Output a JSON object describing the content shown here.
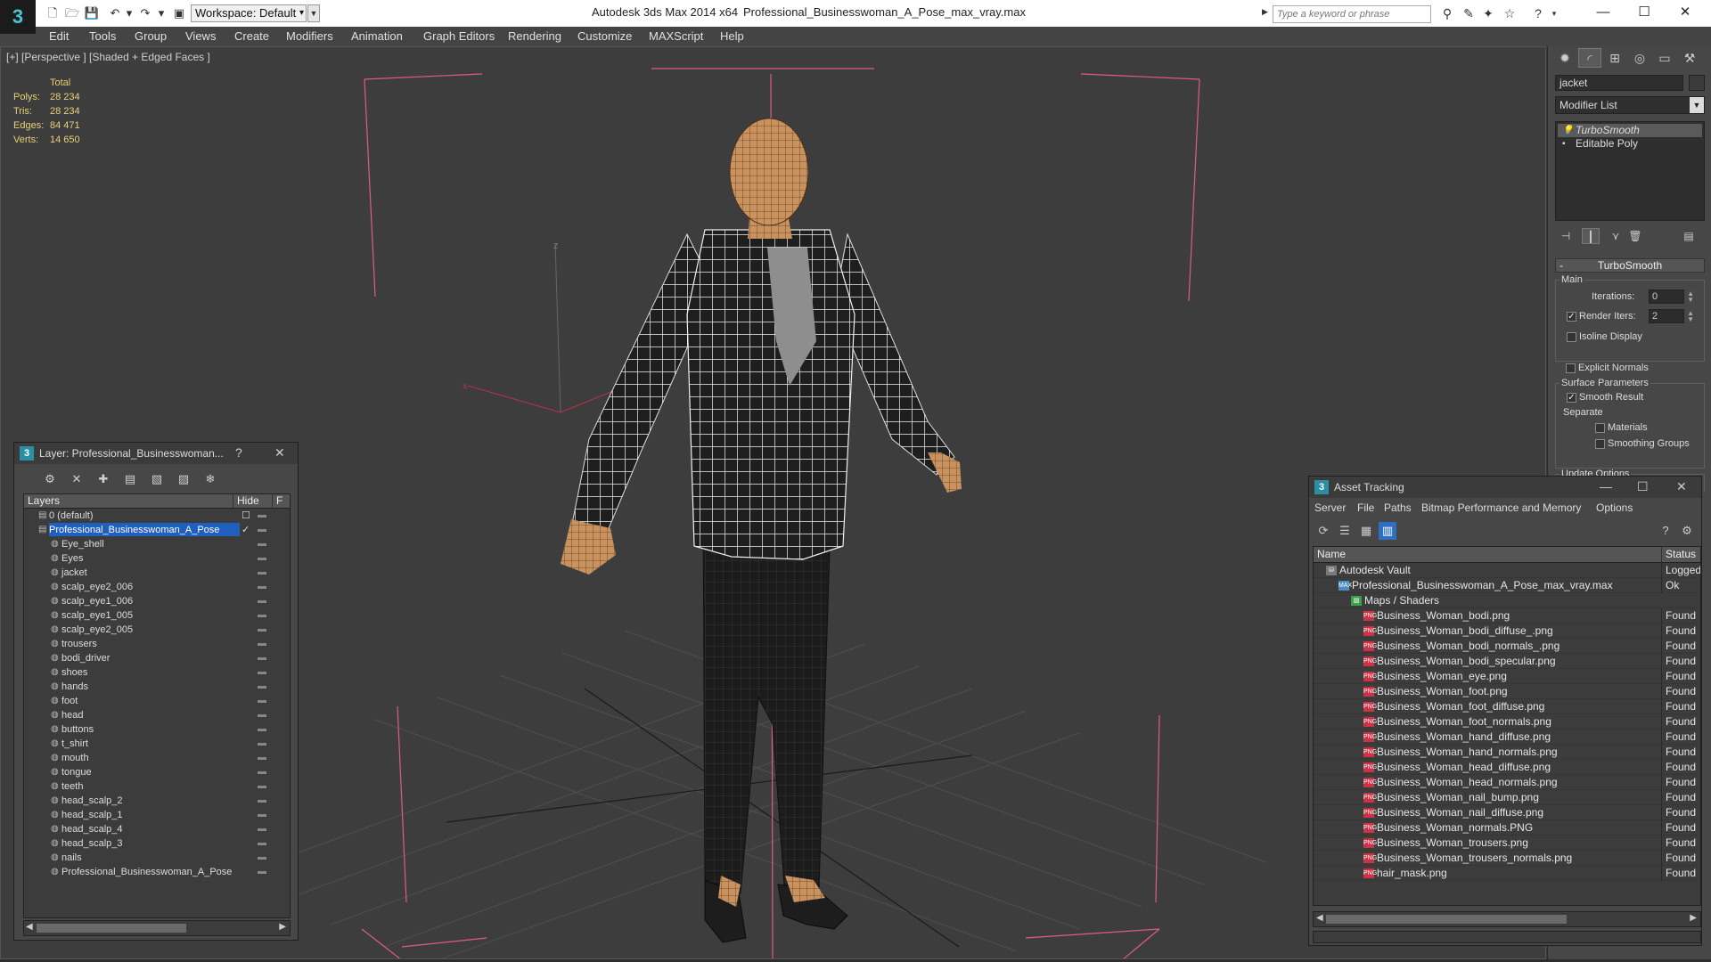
{
  "titlebar": {
    "workspace": "Workspace: Default",
    "app_title": "Autodesk 3ds Max  2014 x64",
    "file_title": "Professional_Businesswoman_A_Pose_max_vray.max",
    "search_placeholder": "Type a keyword or phrase",
    "minimize": "—",
    "maximize": "☐",
    "close": "✕"
  },
  "menu": [
    "Edit",
    "Tools",
    "Group",
    "Views",
    "Create",
    "Modifiers",
    "Animation",
    "Graph Editors",
    "Rendering",
    "Customize",
    "MAXScript",
    "Help"
  ],
  "viewport": {
    "label": "[+] [Perspective ] [Shaded + Edged Faces ]",
    "stats_header": "Total",
    "stats": [
      {
        "label": "Polys:",
        "value": "28 234"
      },
      {
        "label": "Tris:",
        "value": "28 234"
      },
      {
        "label": "Edges:",
        "value": "84 471"
      },
      {
        "label": "Verts:",
        "value": "14 650"
      }
    ],
    "axis_x": "x",
    "axis_z": "z"
  },
  "command_panel": {
    "object_name": "jacket",
    "modifier_list": "Modifier List",
    "stack": [
      {
        "label": "TurboSmooth",
        "selected": true
      },
      {
        "label": "Editable Poly",
        "selected": false
      }
    ],
    "rollout_title": "TurboSmooth",
    "main_group": "Main",
    "iterations_label": "Iterations:",
    "iterations_value": "0",
    "render_iters_label": "Render Iters:",
    "render_iters_value": "2",
    "isoline_label": "Isoline Display",
    "explicit_normals_label": "Explicit Normals",
    "surface_group": "Surface Parameters",
    "smooth_result_label": "Smooth Result",
    "separate_label": "Separate",
    "materials_label": "Materials",
    "smoothing_groups_label": "Smoothing Groups",
    "update_options": "Update Options"
  },
  "layer_panel": {
    "title": "Layer: Professional_Businesswoman...",
    "help": "?",
    "close": "✕",
    "col_layers": "Layers",
    "col_hide": "Hide",
    "col_f": "F",
    "rows": [
      {
        "name": "0 (default)",
        "level": 0,
        "flag": "☐",
        "selected": false
      },
      {
        "name": "Professional_Businesswoman_A_Pose",
        "level": 0,
        "flag": "✓",
        "selected": true
      },
      {
        "name": "Eye_shell",
        "level": 1
      },
      {
        "name": "Eyes",
        "level": 1
      },
      {
        "name": "jacket",
        "level": 1
      },
      {
        "name": "scalp_eye2_006",
        "level": 1
      },
      {
        "name": "scalp_eye1_006",
        "level": 1
      },
      {
        "name": "scalp_eye1_005",
        "level": 1
      },
      {
        "name": "scalp_eye2_005",
        "level": 1
      },
      {
        "name": "trousers",
        "level": 1
      },
      {
        "name": "bodi_driver",
        "level": 1
      },
      {
        "name": "shoes",
        "level": 1
      },
      {
        "name": "hands",
        "level": 1
      },
      {
        "name": "foot",
        "level": 1
      },
      {
        "name": "head",
        "level": 1
      },
      {
        "name": "buttons",
        "level": 1
      },
      {
        "name": "t_shirt",
        "level": 1
      },
      {
        "name": "mouth",
        "level": 1
      },
      {
        "name": "tongue",
        "level": 1
      },
      {
        "name": "teeth",
        "level": 1
      },
      {
        "name": "head_scalp_2",
        "level": 1
      },
      {
        "name": "head_scalp_1",
        "level": 1
      },
      {
        "name": "head_scalp_4",
        "level": 1
      },
      {
        "name": "head_scalp_3",
        "level": 1
      },
      {
        "name": "nails",
        "level": 1
      },
      {
        "name": "Professional_Businesswoman_A_Pose",
        "level": 1
      }
    ]
  },
  "asset_panel": {
    "title": "Asset Tracking",
    "menu": [
      "Server",
      "File",
      "Paths",
      "Bitmap Performance and Memory",
      "Options"
    ],
    "col_name": "Name",
    "col_status": "Status",
    "rows": [
      {
        "name": "Autodesk Vault",
        "level": 0,
        "icon": "vault",
        "status": "Logged Out"
      },
      {
        "name": "Professional_Businesswoman_A_Pose_max_vray.max",
        "level": 1,
        "icon": "max",
        "status": "Ok"
      },
      {
        "name": "Maps / Shaders",
        "level": 2,
        "icon": "maps",
        "status": ""
      },
      {
        "name": "Business_Woman_bodi.png",
        "level": 3,
        "icon": "png",
        "status": "Found"
      },
      {
        "name": "Business_Woman_bodi_diffuse_.png",
        "level": 3,
        "icon": "png",
        "status": "Found"
      },
      {
        "name": "Business_Woman_bodi_normals_.png",
        "level": 3,
        "icon": "png",
        "status": "Found"
      },
      {
        "name": "Business_Woman_bodi_specular.png",
        "level": 3,
        "icon": "png",
        "status": "Found"
      },
      {
        "name": "Business_Woman_eye.png",
        "level": 3,
        "icon": "png",
        "status": "Found"
      },
      {
        "name": "Business_Woman_foot.png",
        "level": 3,
        "icon": "png",
        "status": "Found"
      },
      {
        "name": "Business_Woman_foot_diffuse.png",
        "level": 3,
        "icon": "png",
        "status": "Found"
      },
      {
        "name": "Business_Woman_foot_normals.png",
        "level": 3,
        "icon": "png",
        "status": "Found"
      },
      {
        "name": "Business_Woman_hand_diffuse.png",
        "level": 3,
        "icon": "png",
        "status": "Found"
      },
      {
        "name": "Business_Woman_hand_normals.png",
        "level": 3,
        "icon": "png",
        "status": "Found"
      },
      {
        "name": "Business_Woman_head_diffuse.png",
        "level": 3,
        "icon": "png",
        "status": "Found"
      },
      {
        "name": "Business_Woman_head_normals.png",
        "level": 3,
        "icon": "png",
        "status": "Found"
      },
      {
        "name": "Business_Woman_nail_bump.png",
        "level": 3,
        "icon": "png",
        "status": "Found"
      },
      {
        "name": "Business_Woman_nail_diffuse.png",
        "level": 3,
        "icon": "png",
        "status": "Found"
      },
      {
        "name": "Business_Woman_normals.PNG",
        "level": 3,
        "icon": "png",
        "status": "Found"
      },
      {
        "name": "Business_Woman_trousers.png",
        "level": 3,
        "icon": "png",
        "status": "Found"
      },
      {
        "name": "Business_Woman_trousers_normals.png",
        "level": 3,
        "icon": "png",
        "status": "Found"
      },
      {
        "name": "hair_mask.png",
        "level": 3,
        "icon": "png",
        "status": "Found"
      }
    ]
  },
  "colors": {
    "viewport_bg": "#3d3d3d",
    "selection_blue": "#1f5fbf",
    "bbox_pink": "#e05a88",
    "stats_yellow": "#e6d27a",
    "png_badge": "#c8334a"
  }
}
